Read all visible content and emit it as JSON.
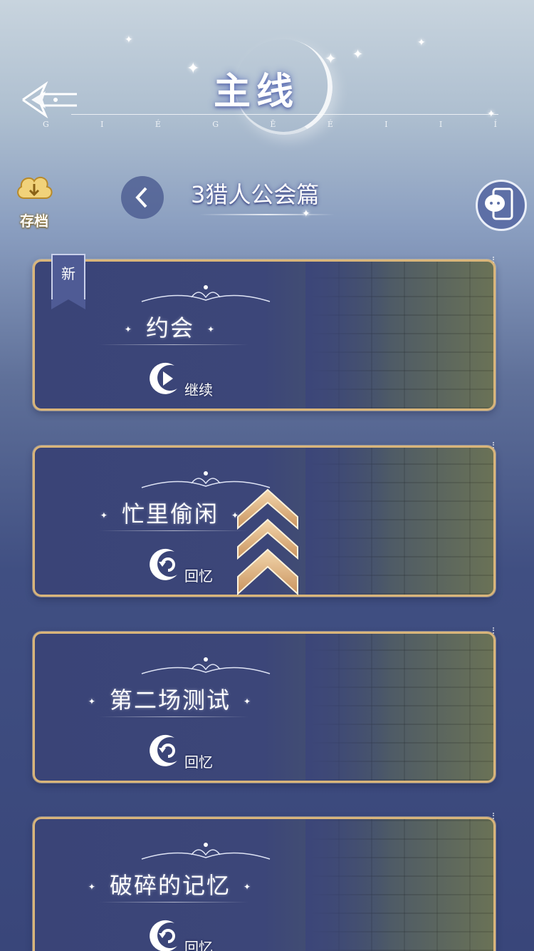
{
  "header": {
    "title": "主线",
    "letters": [
      "G",
      "I",
      "É",
      "G",
      "Ē",
      "É",
      "I",
      "I",
      "Í"
    ]
  },
  "toolbar": {
    "save_label": "存档",
    "chapter_title": "3猎人公会篇"
  },
  "cards": [
    {
      "title": "约会",
      "action": "继续",
      "action_icon": "play-icon",
      "badge": "新"
    },
    {
      "title": "忙里偷闲",
      "action": "回忆",
      "action_icon": "replay-icon"
    },
    {
      "title": "第二场测试",
      "action": "回忆",
      "action_icon": "replay-icon"
    },
    {
      "title": "破碎的记忆",
      "action": "回忆",
      "action_icon": "replay-icon"
    }
  ],
  "colors": {
    "card_border": "#d9b57a",
    "card_bg": "#3a4477",
    "badge_bg": "#4f5b95",
    "chevron": "#e9c89a"
  }
}
